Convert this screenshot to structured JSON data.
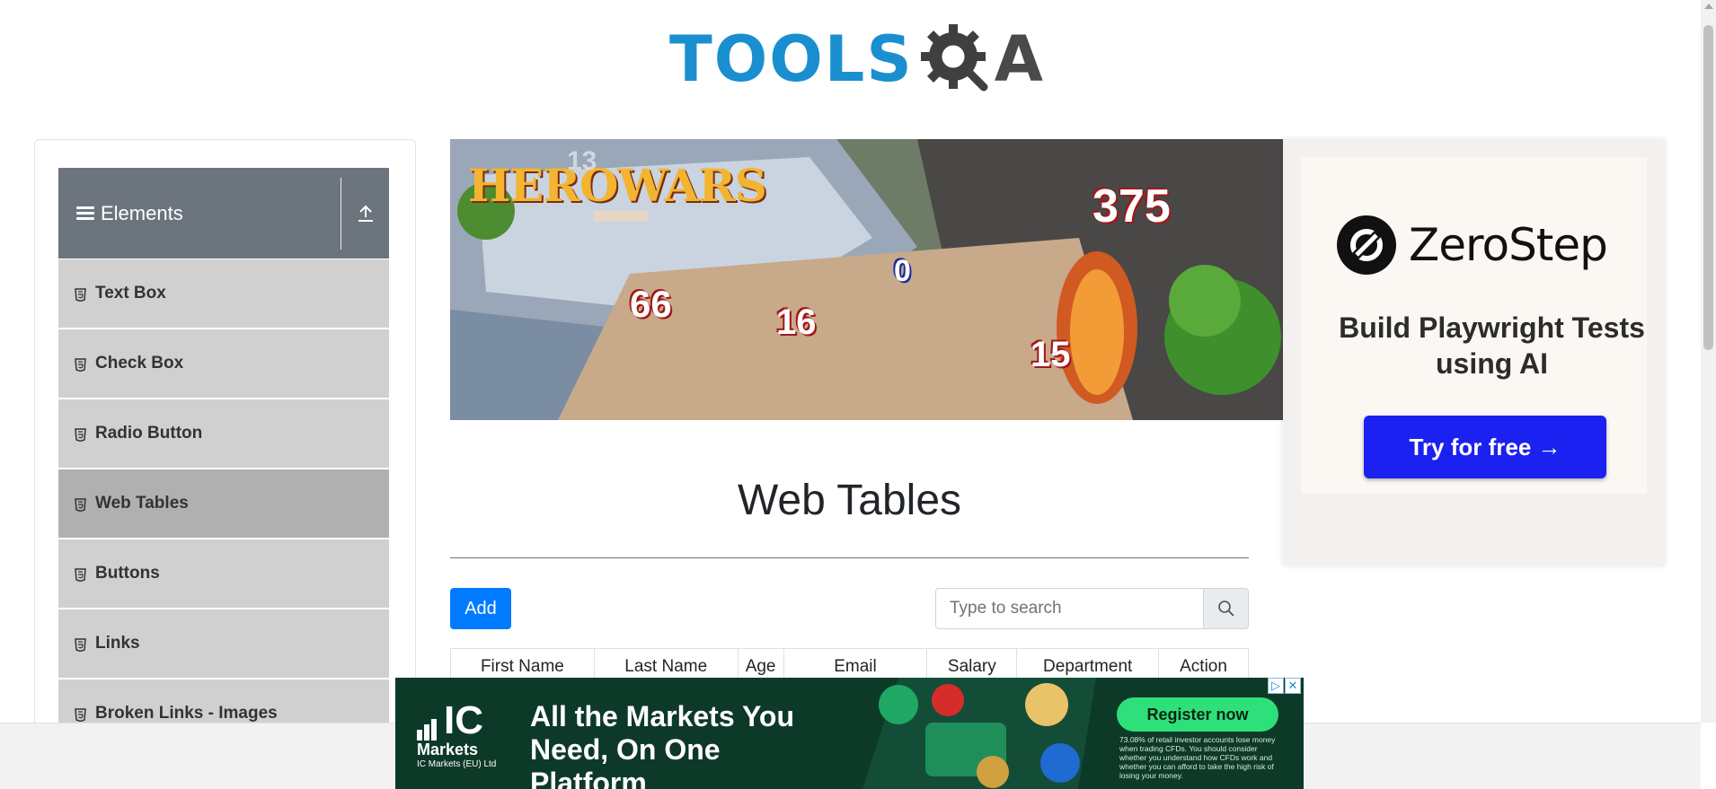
{
  "header": {
    "logo_text_main": "TOOLS",
    "logo_text_end": "A"
  },
  "sidebar": {
    "group_title": "Elements",
    "items": [
      {
        "label": "Text Box"
      },
      {
        "label": "Check Box"
      },
      {
        "label": "Radio Button"
      },
      {
        "label": "Web Tables",
        "active": true
      },
      {
        "label": "Buttons"
      },
      {
        "label": "Links"
      },
      {
        "label": "Broken Links - Images"
      }
    ]
  },
  "banner_ad": {
    "brand": "HEROWARS",
    "numbers": [
      "375",
      "66",
      "16",
      "0",
      "15",
      "13"
    ]
  },
  "side_ad": {
    "brand": "ZeroStep",
    "tagline": "Build Playwright Tests using AI",
    "cta": "Try for free →"
  },
  "main": {
    "title": "Web Tables",
    "add_label": "Add",
    "search": {
      "placeholder": "Type to search",
      "value": ""
    },
    "columns": [
      "First Name",
      "Last Name",
      "Age",
      "Email",
      "Salary",
      "Department",
      "Action"
    ]
  },
  "bottom_ad": {
    "brand": "IC",
    "brand_line": "Markets",
    "brand_sub": "IC Markets (EU) Ltd",
    "headline": "All the Markets You Need, On One Platform",
    "cta": "Register now",
    "risk": "73.08% of retail investor accounts lose money when trading CFDs. You should consider whether you understand how CFDs work and whether you can afford to take the high risk of losing your money.",
    "ad_choice": "▷",
    "close": "✕"
  },
  "colors": {
    "accent": "#007bff",
    "sidebar_header": "#6c757d",
    "logo_blue": "#1a8fd0",
    "zerostep_blue": "#1a21f0"
  }
}
